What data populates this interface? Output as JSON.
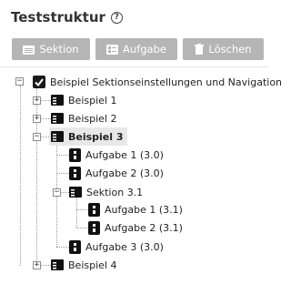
{
  "header": {
    "title": "Teststruktur",
    "help_glyph": "?"
  },
  "toolbar": {
    "section_label": "Sektion",
    "task_label": "Aufgabe",
    "delete_label": "Löschen"
  },
  "tree": {
    "root": "Beispiel Sektionseinstellungen und Navigation",
    "b1": "Beispiel 1",
    "b2": "Beispiel 2",
    "b3": "Beispiel 3",
    "a1": "Aufgabe 1 (3.0)",
    "a2": "Aufgabe 2 (3.0)",
    "s31": "Sektion 3.1",
    "a11": "Aufgabe 1 (3.1)",
    "a21": "Aufgabe 2 (3.1)",
    "a3": "Aufgabe 3 (3.0)",
    "b4": "Beispiel 4",
    "minus": "−",
    "plus": "+"
  }
}
